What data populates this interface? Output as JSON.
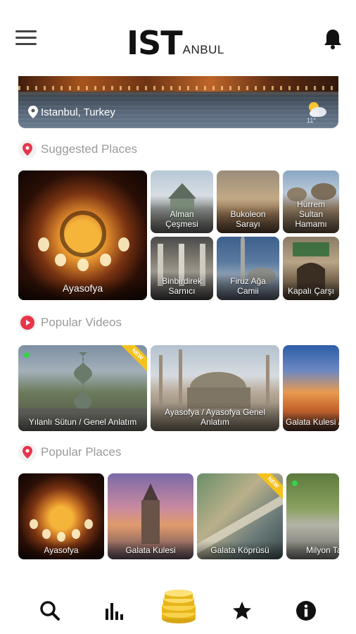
{
  "header": {
    "logo_main": "IST",
    "logo_sub": "ANBUL",
    "menu_icon": "hamburger-menu-icon",
    "bell_icon": "bell-icon"
  },
  "hero": {
    "location": "Istanbul, Turkey",
    "weather_icon": "partly-cloudy-icon",
    "temperature": "11°"
  },
  "sections": {
    "suggested": "Suggested Places",
    "videos": "Popular Videos",
    "popular": "Popular Places"
  },
  "suggested_places": {
    "featured": "Ayasofya",
    "grid": [
      "Alman Çeşmesi",
      "Bukoleon Sarayı",
      "Hürrem Sultan Hamamı",
      "Binbirdirek Sarnıcı",
      "Firuz Ağa Camii",
      "Kapalı Çarşı"
    ]
  },
  "popular_videos": [
    {
      "title": "Yılanlı Sütun / Genel Anlatım",
      "badge": "NEW"
    },
    {
      "title": "Ayasofya / Ayasofya Genel Anlatım"
    },
    {
      "title": "Galata Kulesi / Genel Anlatım"
    }
  ],
  "popular_places": [
    {
      "title": "Ayasofya"
    },
    {
      "title": "Galata Kulesi"
    },
    {
      "title": "Galata Köprüsü",
      "badge": "NEW"
    },
    {
      "title": "Milyon Taşı"
    }
  ],
  "bottom_nav": [
    "search-icon",
    "stats-icon",
    "coins-icon",
    "star-icon",
    "info-icon"
  ],
  "colors": {
    "accent_red": "#e8354a",
    "badge_yellow": "#f4c21d",
    "muted_text": "#9a9a9a"
  }
}
